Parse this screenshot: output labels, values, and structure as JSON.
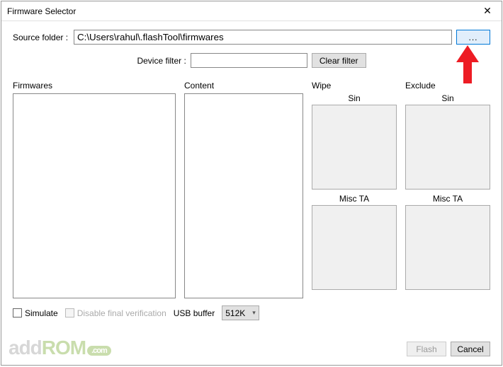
{
  "window": {
    "title": "Firmware Selector"
  },
  "source": {
    "label": "Source folder :",
    "value": "C:\\Users\\rahul\\.flashTool\\firmwares",
    "browse_label": "..."
  },
  "filter": {
    "label": "Device filter :",
    "value": "",
    "clear_label": "Clear filter"
  },
  "columns": {
    "firmwares": "Firmwares",
    "content": "Content",
    "wipe": "Wipe",
    "exclude": "Exclude",
    "sin": "Sin",
    "misc_ta": "Misc TA"
  },
  "options": {
    "simulate": "Simulate",
    "disable_verification": "Disable final verification",
    "usb_buffer_label": "USB buffer",
    "usb_buffer_value": "512K"
  },
  "footer": {
    "flash": "Flash",
    "cancel": "Cancel"
  },
  "watermark": {
    "add": "add",
    "rom": "ROM",
    "dotcom": ".com"
  }
}
